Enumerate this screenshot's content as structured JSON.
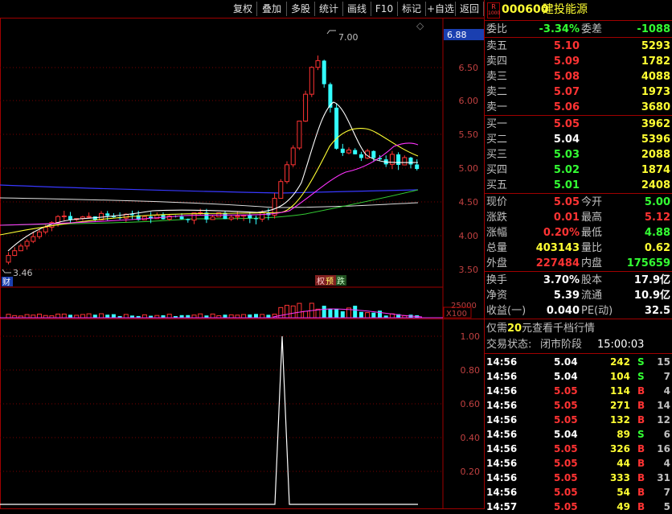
{
  "toolbar": {
    "buttons": [
      "复权",
      "叠加",
      "多股",
      "统计",
      "画线",
      "F10",
      "标记",
      "+自选",
      "返回"
    ]
  },
  "main_chart": {
    "price_axis": [
      "6.50",
      "6.00",
      "5.50",
      "5.00",
      "4.50",
      "4.00",
      "3.50"
    ],
    "current_price_tag": "6.88",
    "high_label": "7.00",
    "low_label": "3.46",
    "caifu_badge": "财",
    "event_badge_1": "权",
    "event_badge_2": "预",
    "event_badge_3": "跌",
    "volume_axis_label": "25000",
    "volume_unit": "X100"
  },
  "indicator_chart": {
    "axis": [
      "1.00",
      "0.80",
      "0.60",
      "0.40",
      "0.20"
    ]
  },
  "stock": {
    "r_badge": "R",
    "r_sub": "1000",
    "code": "000600",
    "name": "建投能源"
  },
  "commission": {
    "ratio_label": "委比",
    "ratio_value": "-3.34%",
    "diff_label": "委差",
    "diff_value": "-1088"
  },
  "sell_orders": [
    {
      "label": "卖五",
      "price": "5.10",
      "volume": "5293"
    },
    {
      "label": "卖四",
      "price": "5.09",
      "volume": "1782"
    },
    {
      "label": "卖三",
      "price": "5.08",
      "volume": "4088"
    },
    {
      "label": "卖二",
      "price": "5.07",
      "volume": "1973"
    },
    {
      "label": "卖一",
      "price": "5.06",
      "volume": "3680"
    }
  ],
  "buy_orders": [
    {
      "label": "买一",
      "price": "5.05",
      "volume": "3962"
    },
    {
      "label": "买二",
      "price": "5.04",
      "volume": "5396"
    },
    {
      "label": "买三",
      "price": "5.03",
      "volume": "2088"
    },
    {
      "label": "买四",
      "price": "5.02",
      "volume": "1874"
    },
    {
      "label": "买五",
      "price": "5.01",
      "volume": "2408"
    }
  ],
  "quote": [
    {
      "l1": "现价",
      "v1": "5.05",
      "l2": "今开",
      "v2": "5.00"
    },
    {
      "l1": "涨跌",
      "v1": "0.01",
      "l2": "最高",
      "v2": "5.12"
    },
    {
      "l1": "涨幅",
      "v1": "0.20%",
      "l2": "最低",
      "v2": "4.88"
    },
    {
      "l1": "总量",
      "v1": "403143",
      "l2": "量比",
      "v2": "0.62"
    },
    {
      "l1": "外盘",
      "v1": "227484",
      "l2": "内盘",
      "v2": "175659"
    }
  ],
  "stats": [
    {
      "l1": "换手",
      "v1": "3.70%",
      "l2": "股本",
      "v2": "17.9亿"
    },
    {
      "l1": "净资",
      "v1": "5.39",
      "l2": "流通",
      "v2": "10.9亿"
    },
    {
      "l1": "收益(一)",
      "v1": "0.040",
      "l2": "PE(动)",
      "v2": "32.5"
    }
  ],
  "promo": {
    "pre": "仅需",
    "num": "20",
    "post": "元查看千档行情"
  },
  "trade_status": {
    "label": "交易状态:",
    "value": "闭市阶段",
    "time": "15:00:03"
  },
  "ticks": [
    {
      "time": "14:56",
      "price": "5.04",
      "vol": "242",
      "bs": "S",
      "n": "15"
    },
    {
      "time": "14:56",
      "price": "5.04",
      "vol": "104",
      "bs": "S",
      "n": "7"
    },
    {
      "time": "14:56",
      "price": "5.05",
      "vol": "114",
      "bs": "B",
      "n": "4"
    },
    {
      "time": "14:56",
      "price": "5.05",
      "vol": "271",
      "bs": "B",
      "n": "14"
    },
    {
      "time": "14:56",
      "price": "5.05",
      "vol": "132",
      "bs": "B",
      "n": "12"
    },
    {
      "time": "14:56",
      "price": "5.04",
      "vol": "89",
      "bs": "S",
      "n": "6"
    },
    {
      "time": "14:56",
      "price": "5.05",
      "vol": "326",
      "bs": "B",
      "n": "16"
    },
    {
      "time": "14:56",
      "price": "5.05",
      "vol": "44",
      "bs": "B",
      "n": "4"
    },
    {
      "time": "14:56",
      "price": "5.05",
      "vol": "333",
      "bs": "B",
      "n": "31"
    },
    {
      "time": "14:56",
      "price": "5.05",
      "vol": "54",
      "bs": "B",
      "n": "7"
    },
    {
      "time": "14:57",
      "price": "5.05",
      "vol": "49",
      "bs": "B",
      "n": "5"
    }
  ],
  "colors": {
    "up": "#ff3333",
    "down": "#33ffff",
    "border": "#a00000"
  }
}
